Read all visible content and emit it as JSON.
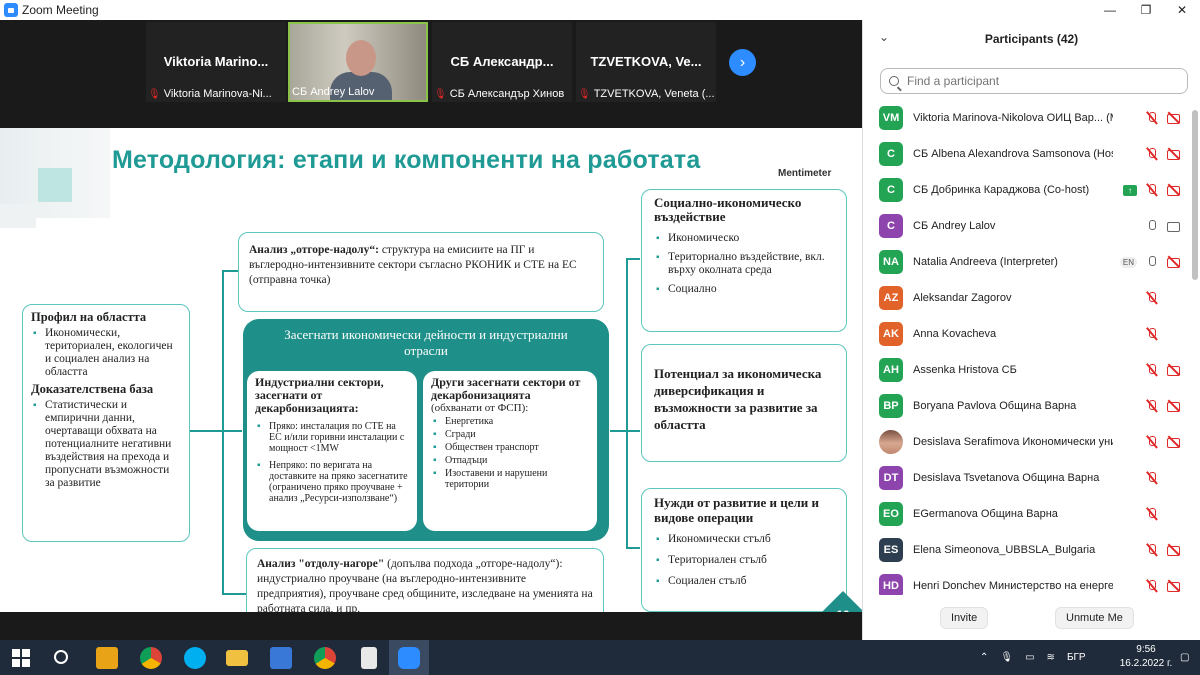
{
  "window": {
    "title": "Zoom Meeting",
    "minimize": "—",
    "maximize": "❐",
    "close": "✕"
  },
  "tiles": [
    {
      "name": "Viktoria Marino...",
      "label": "Viktoria Marinova-Ni..."
    },
    {
      "name": "",
      "label": "СБ Andrey Lalov"
    },
    {
      "name": "СБ Александр...",
      "label": "СБ Александър Хинов"
    },
    {
      "name": "TZVETKOVA, Ve...",
      "label": "TZVETKOVA, Veneta (..."
    }
  ],
  "next_icon": "›",
  "slide": {
    "title": "Методология: етапи и компоненти на работата",
    "brand": "Mentimeter",
    "page_number": "10",
    "profile": {
      "h1": "Профил на областта",
      "b1": "Икономически, териториален, екологичен и социален анализ на областта",
      "h2": "Доказателствена база",
      "b2": "Статистически и емпирични данни, очертаващи обхвата на потенциалните негативни въздействия на прехода и пропуснати възможности за развитие"
    },
    "topdown": {
      "bold": "Анализ „отгоре-надолу“:",
      "text": " структура на емисиите на ПГ и въглеродно-интензивните сектори съгласно РКОНИК и СТЕ на ЕС (отправна точка)"
    },
    "center_title": "Засегнати икономически дейности и индустриални отрасли",
    "industrial": {
      "head": "Индустриални сектори, засегнати от декарбонизацията:",
      "b1": "Пряко: инсталация по СТЕ на ЕС и/или горивни инсталации с мощност <1MW",
      "b2": "Непряко: по веригата на доставките на пряко засегнатите (ограничено пряко проучване + анализ „Ресурси-използване“)"
    },
    "other": {
      "head": "Други засегнати сектори от декарбонизацията",
      "sub": "(обхванати от ФСП):",
      "items": [
        "Енергетика",
        "Сгради",
        "Обществен транспорт",
        "Отпадъци",
        "Изоставени и нарушени територии"
      ]
    },
    "bottomup": {
      "bold": "Анализ \"отдолу-нагоре\"",
      "text": " (допълва подхода „отгоре-надолу“): индустриално проучване (на въглеродно-интензивните предприятия), проучване сред общините, изследване на уменията на работната сила, и пр."
    },
    "impact": {
      "head": "Социално-икономическо въздействие",
      "items": [
        "Икономическо",
        "Териториално въздействие, вкл. върху околната среда",
        "Социално"
      ]
    },
    "potential": {
      "head": "Потенциал за икономическа диверсификация и възможности за развитие за областта"
    },
    "needs": {
      "head": "Нужди от развитие и цели и видове операции",
      "items": [
        "Икономически стълб",
        "Териториален стълб",
        "Социален стълб"
      ]
    }
  },
  "participants": {
    "title": "Participants (42)",
    "search_placeholder": "Find a participant",
    "list": [
      {
        "initials": "VM",
        "color": "#23a455",
        "name": "Viktoria Marinova-Nikolova ОИЦ Вар... (Me)",
        "mic": "muted",
        "cam": "off"
      },
      {
        "initials": "C",
        "color": "#23a455",
        "name": "СБ Albena Alexandrova Samsonova (Host)",
        "mic": "muted",
        "cam": "off"
      },
      {
        "initials": "C",
        "color": "#23a455",
        "name": "СБ Добринка Караджова (Co-host)",
        "mic": "muted",
        "cam": "off",
        "share": true
      },
      {
        "initials": "C",
        "color": "#8e44ad",
        "name": "СБ Andrey Lalov",
        "mic": "on",
        "cam": "on"
      },
      {
        "initials": "NA",
        "color": "#23a455",
        "name": "Natalia Andreeva (Interpreter)",
        "mic": "on",
        "cam": "off",
        "lang": "EN"
      },
      {
        "initials": "AZ",
        "color": "#e2632a",
        "name": "Aleksandar Zagorov",
        "mic": "muted"
      },
      {
        "initials": "AK",
        "color": "#e2632a",
        "name": "Anna Kovacheva",
        "mic": "muted"
      },
      {
        "initials": "AH",
        "color": "#23a455",
        "name": "Assenka Hristova СБ",
        "mic": "muted",
        "cam": "off"
      },
      {
        "initials": "BP",
        "color": "#23a455",
        "name": "Boryana Pavlova Община Варна",
        "mic": "muted",
        "cam": "off"
      },
      {
        "initials": "",
        "color": "#b08060",
        "name": "Desislava Serafimova Икономически унив...",
        "mic": "muted",
        "cam": "off",
        "photo": true
      },
      {
        "initials": "DT",
        "color": "#8e44ad",
        "name": "Desislava Tsvetanova Община Варна",
        "mic": "muted"
      },
      {
        "initials": "EO",
        "color": "#23a455",
        "name": "EGermanova Община Варна",
        "mic": "muted"
      },
      {
        "initials": "ES",
        "color": "#2c3e50",
        "name": "Elena Simeonova_UBBSLA_Bulgaria",
        "mic": "muted",
        "cam": "off"
      },
      {
        "initials": "HD",
        "color": "#8e44ad",
        "name": "Henri Donchev Министерство на енергети...",
        "mic": "muted",
        "cam": "off"
      }
    ],
    "invite": "Invite",
    "unmute": "Unmute Me"
  },
  "taskbar": {
    "lang": "БГР",
    "time": "9:56",
    "date": "16.2.2022 г."
  }
}
